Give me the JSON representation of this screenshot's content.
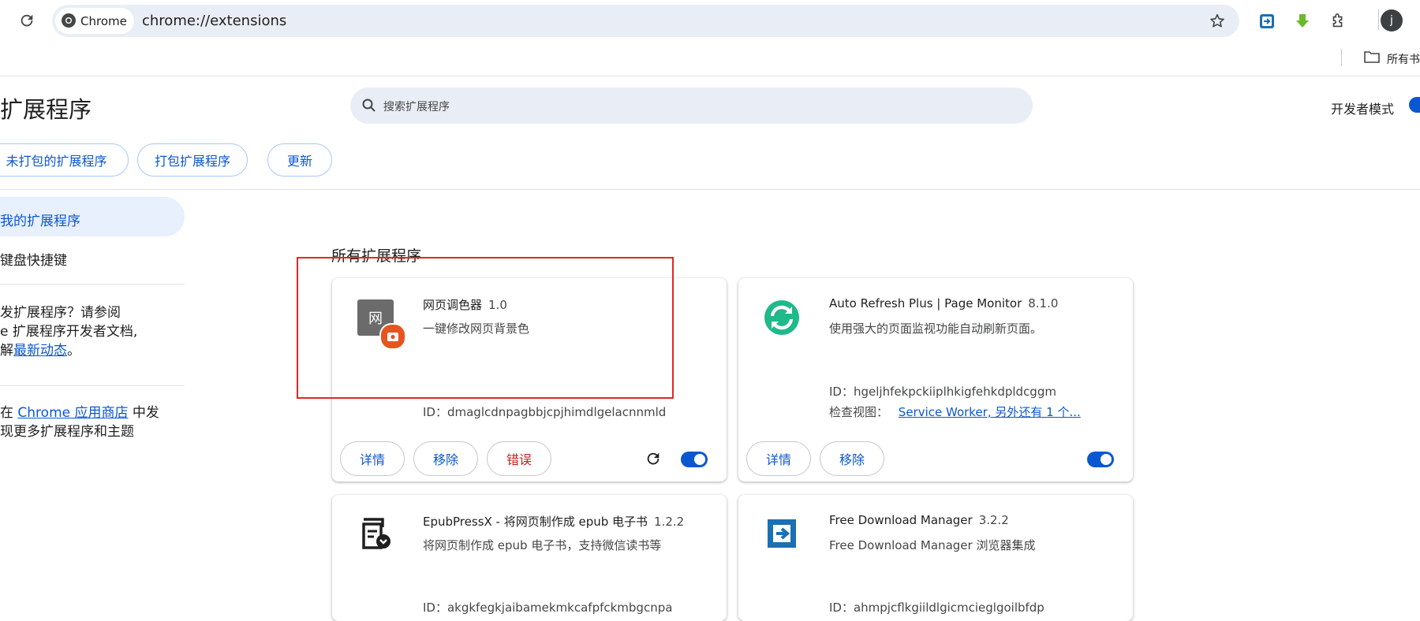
{
  "browser": {
    "chip_label": "Chrome",
    "url": "chrome://extensions",
    "bookmark_folder_label": "所有书",
    "profile_initial": "j"
  },
  "header": {
    "title": "扩展程序",
    "search_placeholder": "搜索扩展程序",
    "dev_mode_label": "开发者模式",
    "dev_mode_on": true,
    "buttons": {
      "load_unpacked": "未打包的扩展程序",
      "pack": "打包扩展程序",
      "update": "更新"
    }
  },
  "sidebar": {
    "my_extensions": "我的扩展程序",
    "shortcuts": "键盘快捷键",
    "dev_text": {
      "line1": "发扩展程序？请参阅",
      "line2": "e 扩展程序开发者文档,",
      "line3_prefix": "解",
      "line3_link": "最新动态",
      "line3_suffix": "。"
    },
    "store_text": {
      "line1_prefix": "在 ",
      "line1_link": "Chrome 应用商店",
      "line1_suffix": " 中发",
      "line2": "现更多扩展程序和主题"
    }
  },
  "main": {
    "section_title": "所有扩展程序",
    "cards": [
      {
        "icon_letter": "网",
        "name": "网页调色器",
        "version": "1.0",
        "description": "一键修改网页背景色",
        "id_line": "ID：dmaglcdnpagbbjcpjhimdlgelacnnmld",
        "buttons": {
          "details": "详情",
          "remove": "移除",
          "errors": "错误"
        },
        "enabled": true
      },
      {
        "name": "Auto Refresh Plus | Page Monitor",
        "version": "8.1.0",
        "description": "使用强大的页面监视功能自动刷新页面。",
        "id_line": "ID：hgeljhfekpckiiplhkigfehkdpldcggm",
        "inspect_label": "检查视图：",
        "inspect_link": "Service Worker, 另外还有 1 个...",
        "buttons": {
          "details": "详情",
          "remove": "移除"
        },
        "enabled": true
      },
      {
        "name": "EpubPressX - 将网页制作成 epub 电子书",
        "version": "1.2.2",
        "description": "将网页制作成 epub 电子书，支持微信读书等",
        "id_line": "ID：akgkfegkjaibamekmkcafpfckmbgcnpa"
      },
      {
        "name": "Free Download Manager",
        "version": "3.2.2",
        "description": "Free Download Manager 浏览器集成",
        "id_line": "ID：ahmpjcflkgiildlgicmcieglgoilbfdp"
      }
    ]
  },
  "colors": {
    "accent": "#0b57d0",
    "highlight_box": "#e8251f",
    "error_text": "#c5221f",
    "auto_refresh_green": "#1fb98a",
    "fdm_blue": "#1a6fb5"
  }
}
